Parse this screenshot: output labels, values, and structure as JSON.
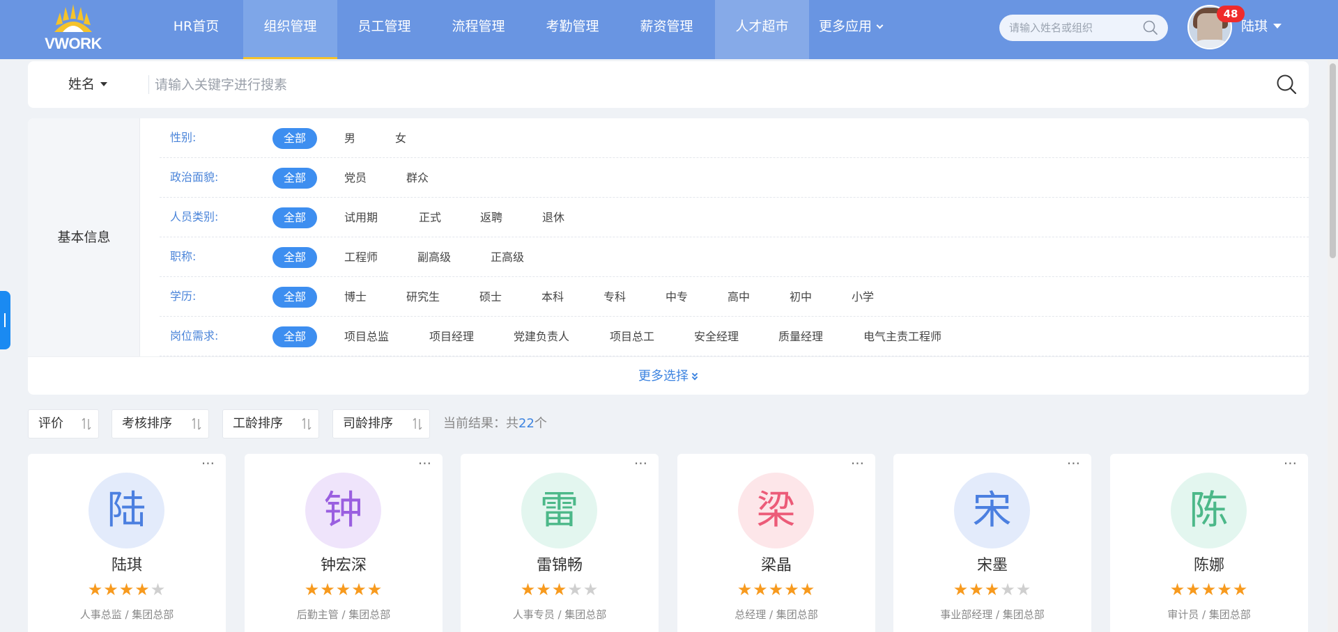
{
  "header": {
    "logo_text": "VWORK",
    "nav": [
      {
        "label": "HR首页"
      },
      {
        "label": "组织管理"
      },
      {
        "label": "员工管理"
      },
      {
        "label": "流程管理"
      },
      {
        "label": "考勤管理"
      },
      {
        "label": "薪资管理"
      },
      {
        "label": "人才超市"
      }
    ],
    "more_apps": "更多应用",
    "search_placeholder": "请输入姓名或组织",
    "notification_count": "48",
    "user_name": "陆琪",
    "colors": {
      "bar": "#6995e2",
      "active_underline": "#f5c32b",
      "badge": "#ef2b2b"
    }
  },
  "search": {
    "field": "姓名",
    "placeholder": "请输入关键字进行搜素"
  },
  "filters": {
    "section_title": "基本信息",
    "rows": [
      {
        "label": "性别:",
        "options": [
          "全部",
          "男",
          "女"
        ]
      },
      {
        "label": "政治面貌:",
        "options": [
          "全部",
          "党员",
          "群众"
        ]
      },
      {
        "label": "人员类别:",
        "options": [
          "全部",
          "试用期",
          "正式",
          "返聘",
          "退休"
        ]
      },
      {
        "label": "职称:",
        "options": [
          "全部",
          "工程师",
          "副高级",
          "正高级"
        ]
      },
      {
        "label": "学历:",
        "options": [
          "全部",
          "博士",
          "研究生",
          "硕士",
          "本科",
          "专科",
          "中专",
          "高中",
          "初中",
          "小学"
        ]
      },
      {
        "label": "岗位需求:",
        "options": [
          "全部",
          "项目总监",
          "项目经理",
          "党建负责人",
          "项目总工",
          "安全经理",
          "质量经理",
          "电气主责工程师"
        ]
      }
    ],
    "selected": "全部",
    "more_label": "更多选择",
    "accent": "#3d8ef0"
  },
  "sort": {
    "buttons": [
      "评价",
      "考核排序",
      "工龄排序",
      "司龄排序"
    ],
    "result_prefix": "当前结果：共",
    "result_count": "22",
    "result_suffix": "个"
  },
  "employees": [
    {
      "initial": "陆",
      "name": "陆琪",
      "rating": 4,
      "role": "人事总监 / 集团总部",
      "bg": "#e3ebfb",
      "fg": "#4b7fe0"
    },
    {
      "initial": "钟",
      "name": "钟宏深",
      "rating": 5,
      "role": "后勤主管 / 集团总部",
      "bg": "#efe4fb",
      "fg": "#9a5fe0"
    },
    {
      "initial": "雷",
      "name": "雷锦畅",
      "rating": 3,
      "role": "人事专员 / 集团总部",
      "bg": "#e3f6ef",
      "fg": "#4cb889"
    },
    {
      "initial": "梁",
      "name": "梁晶",
      "rating": 5,
      "role": "总经理 / 集团总部",
      "bg": "#fde6e9",
      "fg": "#ec5b78"
    },
    {
      "initial": "宋",
      "name": "宋墨",
      "rating": 3,
      "role": "事业部经理 / 集团总部",
      "bg": "#e3ebfb",
      "fg": "#4b7fe0"
    },
    {
      "initial": "陈",
      "name": "陈娜",
      "rating": 5,
      "role": "审计员 / 集团总部",
      "bg": "#e3f6ef",
      "fg": "#4cb889"
    }
  ],
  "star_colors": {
    "on": "#f79a1e",
    "off": "#cfcfcf"
  }
}
